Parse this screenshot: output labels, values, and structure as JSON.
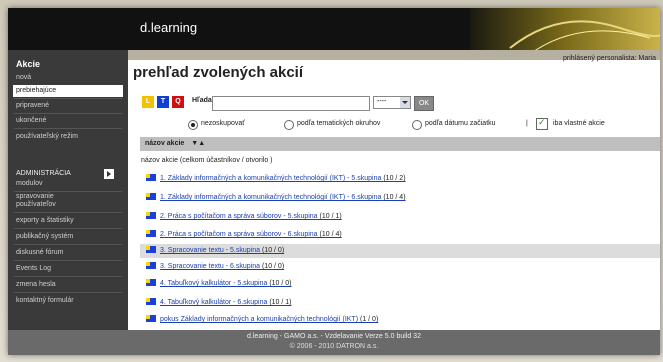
{
  "header": {
    "brand": "d.learning",
    "user_line": "prihlásený personalista: Maria"
  },
  "sidebar": {
    "section_title": "Akcie",
    "items": [
      {
        "label": "nová",
        "active": false
      },
      {
        "label": "prebiehajúce",
        "active": true
      },
      {
        "label": "pripravené",
        "active": false
      },
      {
        "label": "ukončené",
        "active": false
      },
      {
        "label": "používateľský režim",
        "active": false
      },
      {
        "label": "ADMINISTRÁCIA",
        "active": false
      },
      {
        "label": "modulov",
        "active": false
      },
      {
        "label": "spravovanie",
        "active": false
      },
      {
        "label": "používateľov",
        "active": false
      },
      {
        "label": "exporty a štatistiky",
        "active": false
      },
      {
        "label": "publikačný systém",
        "active": false
      },
      {
        "label": "diskusné fórum",
        "active": false
      },
      {
        "label": "Events Log",
        "active": false
      },
      {
        "label": "zmena hesla",
        "active": false
      },
      {
        "label": "kontaktný formulár",
        "active": false
      }
    ]
  },
  "main": {
    "title": "prehľad zvolených akcií",
    "filter": {
      "labels": [
        {
          "text": "L",
          "color": "#f2c200"
        },
        {
          "text": "T",
          "color": "#1040d0"
        },
        {
          "text": "Q",
          "color": "#d01010"
        }
      ],
      "search_label": "Hľadať",
      "search_value": "",
      "select_value": "----",
      "ok_label": "OK"
    },
    "grouping": {
      "options": [
        "nezoskupovať",
        "podľa tematických okruhov",
        "podľa dátumu začiatku"
      ],
      "selected": 0,
      "separator": "|",
      "own_only_label": "iba vlastné akcie",
      "own_only_checked": true
    },
    "table": {
      "header": "názov akcie",
      "sort_icons": "▼▲",
      "subheader": "názov akcie (celkom účastníkov / otvorilo )",
      "rows": [
        {
          "name": "1. Základy informačných a komunikačných technológií (IKT) - 5.skupina",
          "count": "(10 / 2)",
          "highlight": false
        },
        {
          "name": "1. Základy informačných a komunikačných technológií (IKT) - 6.skupina",
          "count": "(10 / 4)",
          "highlight": false
        },
        {
          "name": "2. Práca s počítačom a správa súborov - 5.skupina",
          "count": "(10 / 1)",
          "highlight": false
        },
        {
          "name": "2. Práca s počítačom a správa súborov - 6.skupina",
          "count": "(10 / 4)",
          "highlight": false
        },
        {
          "name": "3. Spracovanie textu - 5.skupina",
          "count": "(10 / 0)",
          "highlight": true
        },
        {
          "name": "3. Spracovanie textu - 6.skupina",
          "count": "(10 / 0)",
          "highlight": false
        },
        {
          "name": "4. Tabuľkový kalkulátor - 5.skupina",
          "count": "(10 / 0)",
          "highlight": false
        },
        {
          "name": "4. Tabuľkový kalkulátor - 6.skupina",
          "count": "(10 / 1)",
          "highlight": false
        },
        {
          "name": "pokus Základy informačných a komunikačných technológií (IKT)",
          "count": "(1 / 0)",
          "highlight": false
        }
      ]
    }
  },
  "footer": {
    "line1": "d.learning - GAMO a.s. - Vzdelavanie Verze 5.0 build 32",
    "line2": "© 2006 - 2010 DATRON a.s."
  }
}
